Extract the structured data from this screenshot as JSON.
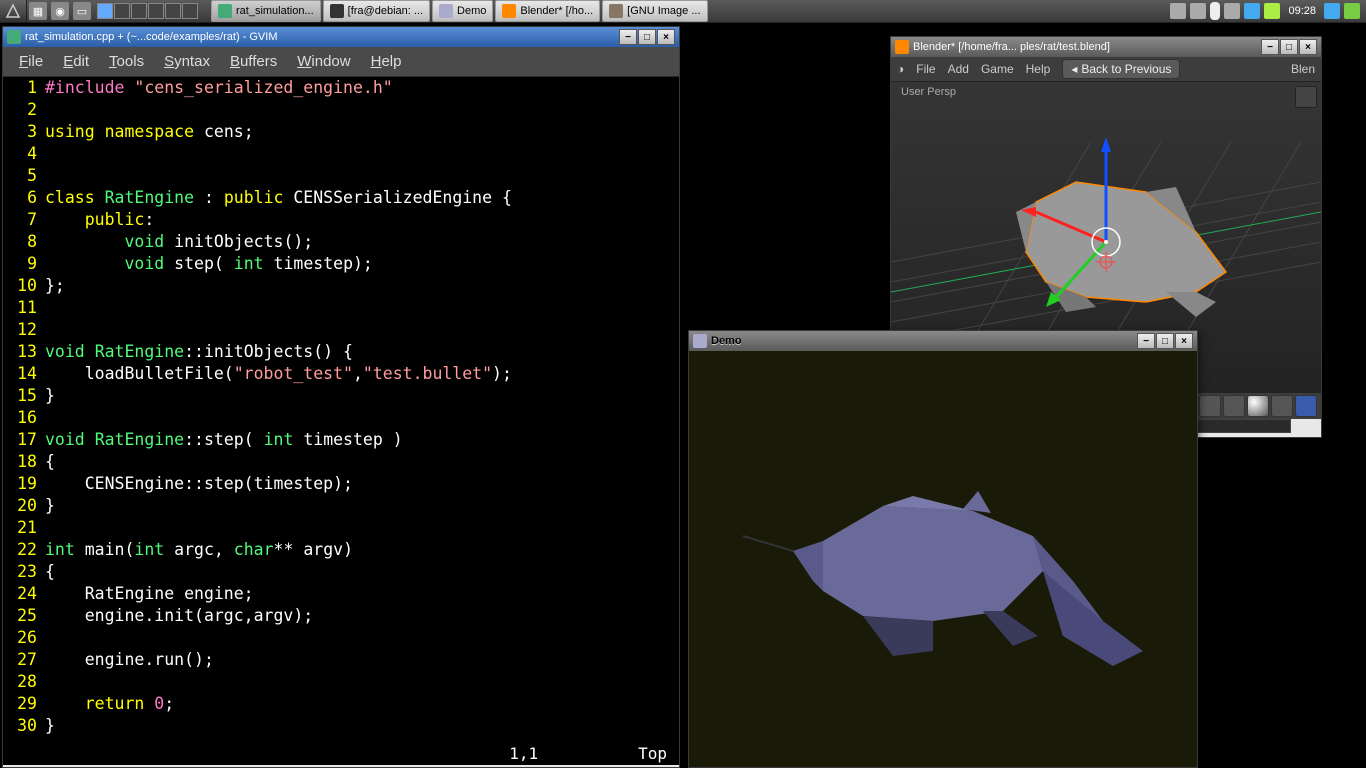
{
  "taskbar": {
    "tasks": [
      {
        "label": "rat_simulation..."
      },
      {
        "label": "[fra@debian: ..."
      },
      {
        "label": "Demo"
      },
      {
        "label": "Blender* [/ho..."
      },
      {
        "label": "[GNU Image ..."
      }
    ],
    "clock": "09:28"
  },
  "gvim": {
    "title": "rat_simulation.cpp + (~...code/examples/rat) - GVIM",
    "menus": [
      "File",
      "Edit",
      "Tools",
      "Syntax",
      "Buffers",
      "Window",
      "Help"
    ],
    "status_pos": "1,1",
    "status_scroll": "Top",
    "code": [
      {
        "n": 1,
        "tokens": [
          [
            "pp",
            "#include "
          ],
          [
            "str",
            "\"cens_serialized_engine.h\""
          ]
        ]
      },
      {
        "n": 2,
        "tokens": []
      },
      {
        "n": 3,
        "tokens": [
          [
            "kw",
            "using "
          ],
          [
            "kw",
            "namespace "
          ],
          [
            "",
            ""
          ],
          [
            "",
            "cens;"
          ]
        ]
      },
      {
        "n": 4,
        "tokens": []
      },
      {
        "n": 5,
        "tokens": []
      },
      {
        "n": 6,
        "tokens": [
          [
            "kw",
            "class "
          ],
          [
            "ty",
            "RatEngine"
          ],
          [
            "",
            " : "
          ],
          [
            "kw",
            "public "
          ],
          [
            "",
            "CENSSerializedEngine {"
          ]
        ]
      },
      {
        "n": 7,
        "tokens": [
          [
            "",
            "    "
          ],
          [
            "kw",
            "public"
          ],
          [
            "",
            ":"
          ]
        ]
      },
      {
        "n": 8,
        "tokens": [
          [
            "",
            "        "
          ],
          [
            "ty",
            "void"
          ],
          [
            "",
            " initObjects();"
          ]
        ]
      },
      {
        "n": 9,
        "tokens": [
          [
            "",
            "        "
          ],
          [
            "ty",
            "void"
          ],
          [
            "",
            " step( "
          ],
          [
            "ty",
            "int"
          ],
          [
            "",
            " timestep);"
          ]
        ]
      },
      {
        "n": 10,
        "tokens": [
          [
            "",
            "};"
          ]
        ]
      },
      {
        "n": 11,
        "tokens": []
      },
      {
        "n": 12,
        "tokens": []
      },
      {
        "n": 13,
        "tokens": [
          [
            "ty",
            "void"
          ],
          [
            "",
            " "
          ],
          [
            "ty",
            "RatEngine"
          ],
          [
            "",
            "::initObjects() {"
          ]
        ]
      },
      {
        "n": 14,
        "tokens": [
          [
            "",
            "    loadBulletFile("
          ],
          [
            "str",
            "\"robot_test\""
          ],
          [
            "",
            ","
          ],
          [
            "str",
            "\"test.bullet\""
          ],
          [
            "",
            ");"
          ]
        ]
      },
      {
        "n": 15,
        "tokens": [
          [
            "",
            "}"
          ]
        ]
      },
      {
        "n": 16,
        "tokens": []
      },
      {
        "n": 17,
        "tokens": [
          [
            "ty",
            "void"
          ],
          [
            "",
            " "
          ],
          [
            "ty",
            "RatEngine"
          ],
          [
            "",
            "::step( "
          ],
          [
            "ty",
            "int"
          ],
          [
            "",
            " timestep )"
          ]
        ]
      },
      {
        "n": 18,
        "tokens": [
          [
            "",
            "{"
          ]
        ]
      },
      {
        "n": 19,
        "tokens": [
          [
            "",
            "    CENSEngine::step(timestep);"
          ]
        ]
      },
      {
        "n": 20,
        "tokens": [
          [
            "",
            "}"
          ]
        ]
      },
      {
        "n": 21,
        "tokens": []
      },
      {
        "n": 22,
        "tokens": [
          [
            "ty",
            "int"
          ],
          [
            "",
            " main("
          ],
          [
            "ty",
            "int"
          ],
          [
            "",
            " argc, "
          ],
          [
            "ty",
            "char"
          ],
          [
            "",
            "** argv)"
          ]
        ]
      },
      {
        "n": 23,
        "tokens": [
          [
            "",
            "{"
          ]
        ]
      },
      {
        "n": 24,
        "tokens": [
          [
            "",
            "    RatEngine engine;"
          ]
        ]
      },
      {
        "n": 25,
        "tokens": [
          [
            "",
            "    engine.init(argc,argv);"
          ]
        ]
      },
      {
        "n": 26,
        "tokens": []
      },
      {
        "n": 27,
        "tokens": [
          [
            "",
            "    engine.run();"
          ]
        ]
      },
      {
        "n": 28,
        "tokens": []
      },
      {
        "n": 29,
        "tokens": [
          [
            "",
            "    "
          ],
          [
            "kw",
            "return "
          ],
          [
            "num",
            "0"
          ],
          [
            "",
            ";"
          ]
        ]
      },
      {
        "n": 30,
        "tokens": [
          [
            "",
            "}"
          ]
        ]
      }
    ]
  },
  "blender": {
    "title": "Blender* [/home/fra... ples/rat/test.blend]",
    "menus": [
      "File",
      "Add",
      "Game",
      "Help"
    ],
    "back_btn": "Back to Previous",
    "right_label": "Blen",
    "persp": "User Persp"
  },
  "demo": {
    "title": "Demo"
  }
}
